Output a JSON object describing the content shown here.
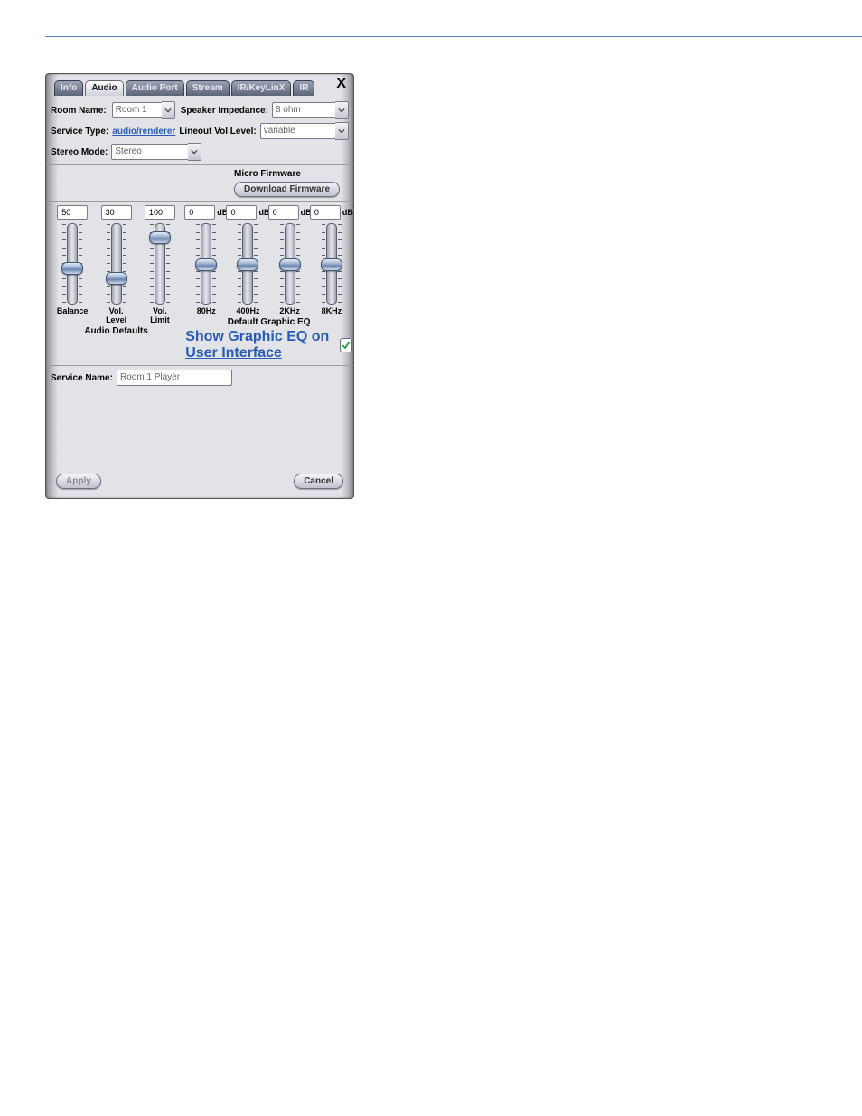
{
  "tabs": [
    "Info",
    "Audio",
    "Audio Port",
    "Stream",
    "IR/KeyLinX",
    "IR"
  ],
  "tabs_active_index": 1,
  "close_label": "X",
  "form": {
    "room_name_label": "Room Name:",
    "room_name_value": "Room 1",
    "speaker_imp_label": "Speaker Impedance:",
    "speaker_imp_value": "8 ohm",
    "service_type_label": "Service Type:",
    "service_type_value": "audio/renderer",
    "lineout_label": "Lineout Vol Level:",
    "lineout_value": "variable",
    "stereo_label": "Stereo Mode:",
    "stereo_value": "Stereo",
    "micro_fw_label": "Micro Firmware",
    "download_fw_label": "Download Firmware",
    "service_name_label": "Service Name:",
    "service_name_value": "Room 1 Player"
  },
  "left_sliders": [
    {
      "value": "50",
      "pos": 0.55,
      "label": "Balance"
    },
    {
      "value": "30",
      "pos": 0.7,
      "label": "Vol.\nLevel"
    },
    {
      "value": "100",
      "pos": 0.1,
      "label": "Vol.\nLimit"
    }
  ],
  "left_defaults_label": "Audio Defaults",
  "eq_sliders": [
    {
      "value": "0",
      "pos": 0.5,
      "label": "80Hz"
    },
    {
      "value": "0",
      "pos": 0.5,
      "label": "400Hz"
    },
    {
      "value": "0",
      "pos": 0.5,
      "label": "2KHz"
    },
    {
      "value": "0",
      "pos": 0.5,
      "label": "8KHz"
    }
  ],
  "db_unit": "dB",
  "eq_default_label": "Default Graphic EQ",
  "show_eq_label": "Show Graphic EQ on User Interface",
  "apply_label": "Apply",
  "cancel_label": "Cancel"
}
